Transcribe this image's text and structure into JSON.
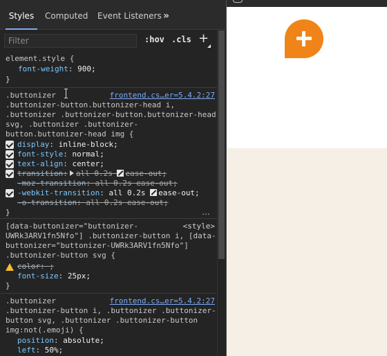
{
  "tabs": {
    "styles": "Styles",
    "computed": "Computed",
    "event_listeners": "Event Listeners",
    "more": "»"
  },
  "filter": {
    "placeholder": "Filter",
    "hov": ":hov",
    "cls": ".cls",
    "new_rule": "+"
  },
  "rules": {
    "element_style": {
      "selector": "element.style {",
      "prop": "font-weight",
      "value": "900;",
      "close": "}"
    },
    "buttonizer_head": {
      "source": "frontend.cs…er=5.4.2:27",
      "selector_lines": [
        ".buttonizer",
        ".buttonizer-button.buttonizer-head i,",
        ".buttonizer .buttonizer-button.buttonizer-head",
        "svg, .buttonizer .buttonizer-",
        "button.buttonizer-head img {"
      ],
      "decls": [
        {
          "prop": "display",
          "value": "inline-block;"
        },
        {
          "prop": "font-style",
          "value": "normal;"
        },
        {
          "prop": "text-align",
          "value": "center;"
        },
        {
          "prop": "transition",
          "value_a": "all 0.2s",
          "value_b": "ease-out;"
        },
        {
          "prop": "-moz-transition",
          "value": "all 0.2s ease-out;"
        },
        {
          "prop": "-webkit-transition",
          "value_a": "all 0.2s",
          "value_b": "ease-out;"
        },
        {
          "prop": "-o-transition",
          "value": "all 0.2s ease-out;"
        }
      ],
      "more": "…",
      "close": "}"
    },
    "buttonizer_attr": {
      "source": "<style>",
      "selector_lines": [
        "[data-buttonizer=\"buttonizer-",
        "UWRk3ARV1fn5Nfo\"] .buttonizer-button i, [data-",
        "buttonizer=\"buttonizer-UWRk3ARV1fn5Nfo\"]",
        ".buttonizer-button svg {"
      ],
      "decls": [
        {
          "prop": "color",
          "value": ";"
        },
        {
          "prop": "font-size",
          "value": "25px;"
        }
      ],
      "close": "}"
    },
    "buttonizer_emoji": {
      "source": "frontend.cs…er=5.4.2:27",
      "selector_lines": [
        ".buttonizer",
        ".buttonizer-button i, .buttonizer .buttonizer-",
        "button svg, .buttonizer .buttonizer-button",
        "img:not(.emoji) {"
      ],
      "decls": [
        {
          "prop": "position",
          "value": "absolute;"
        },
        {
          "prop": "left",
          "value": "50%;"
        }
      ]
    }
  },
  "colors": {
    "button_accent": "#f08419",
    "preview_bottom": "#f6efe6",
    "active_tab_underline": "#7cacf8"
  }
}
